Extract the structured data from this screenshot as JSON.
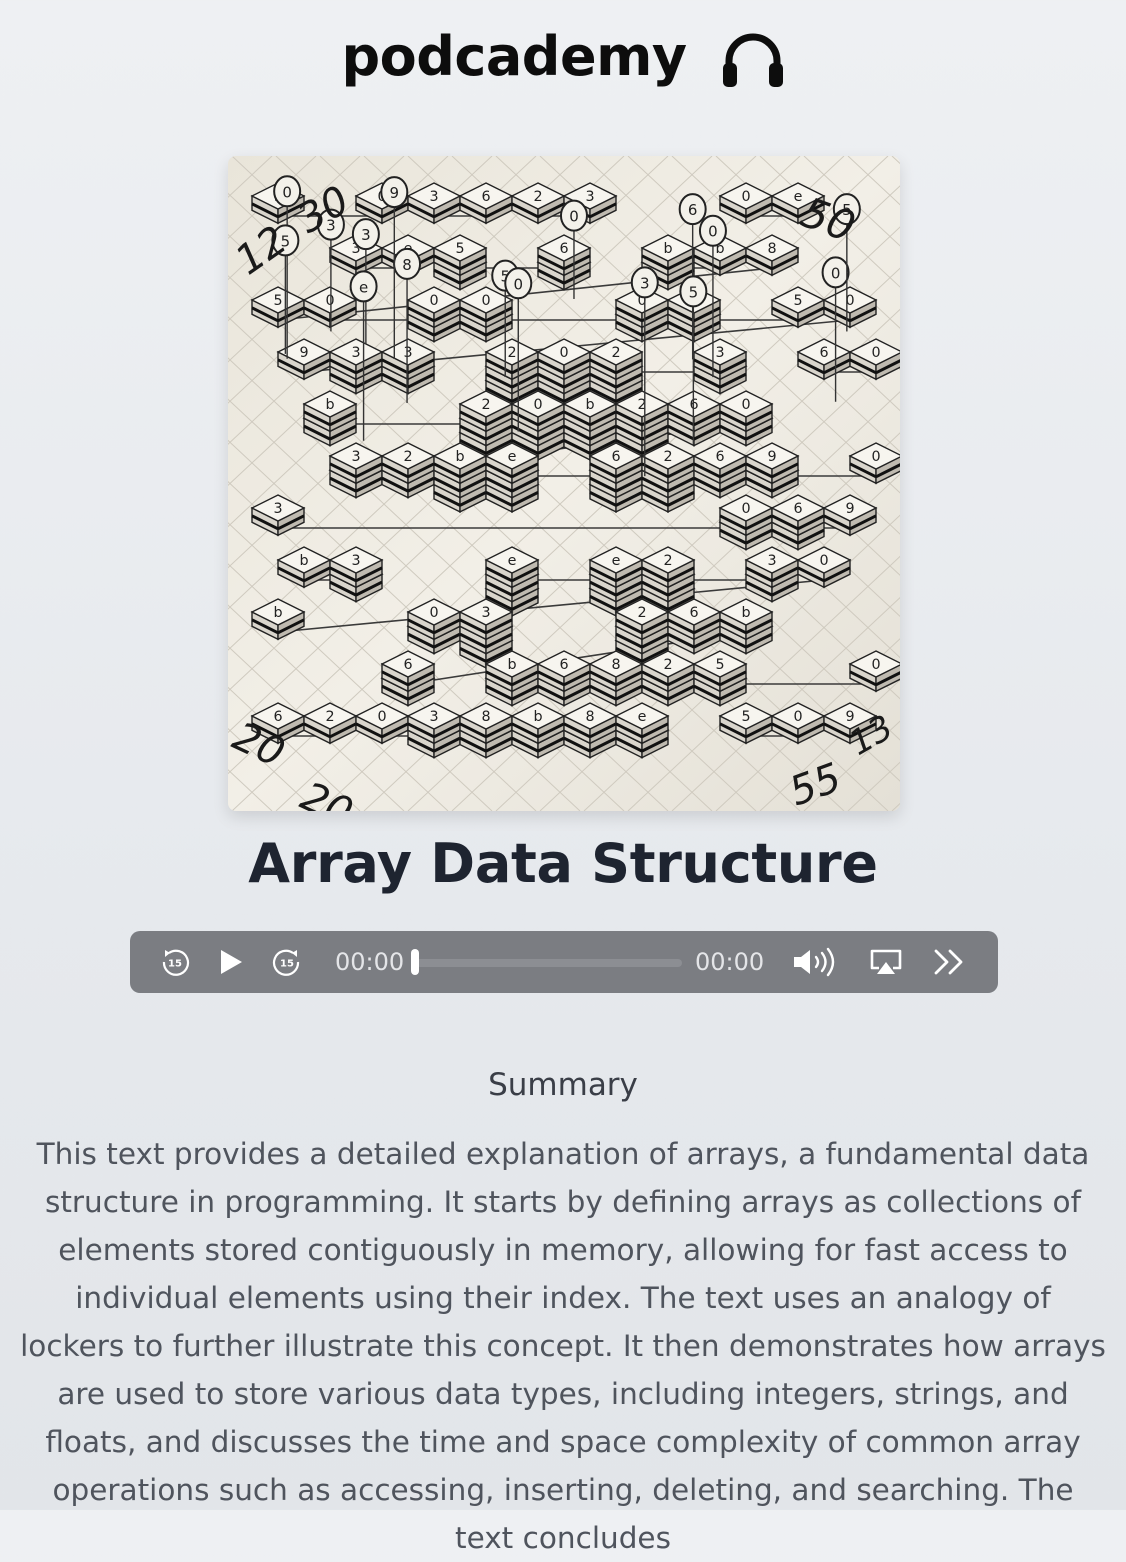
{
  "brand": {
    "name": "podcademy",
    "icon": "headphones-icon"
  },
  "cover": {
    "alt": "Array Data Structure",
    "art_labels": [
      "12",
      "30",
      "50",
      "20",
      "20",
      "55",
      "13"
    ]
  },
  "episode": {
    "title": "Array Data Structure"
  },
  "player": {
    "current_time": "00:00",
    "duration": "00:00",
    "progress": 0,
    "icons": {
      "rewind": "rewind-15-icon",
      "play": "play-icon",
      "forward": "forward-15-icon",
      "volume": "volume-icon",
      "airplay": "airplay-icon",
      "speed": "playback-speed-icon"
    },
    "skip_seconds": "15"
  },
  "summary": {
    "heading": "Summary",
    "text": "This text provides a detailed explanation of arrays, a fundamental data structure in programming. It starts by defining arrays as collections of elements stored contiguously in memory, allowing for fast access to individual elements using their index. The text uses an analogy of lockers to further illustrate this concept. It then demonstrates how arrays are used to store various data types, including integers, strings, and floats, and discusses the time and space complexity of common array operations such as accessing, inserting, deleting, and searching. The text concludes"
  },
  "colors": {
    "background": "#e9ecef",
    "player_bg": "#7b7d82",
    "title": "#1e2430",
    "summary_text": "#4f545d"
  }
}
